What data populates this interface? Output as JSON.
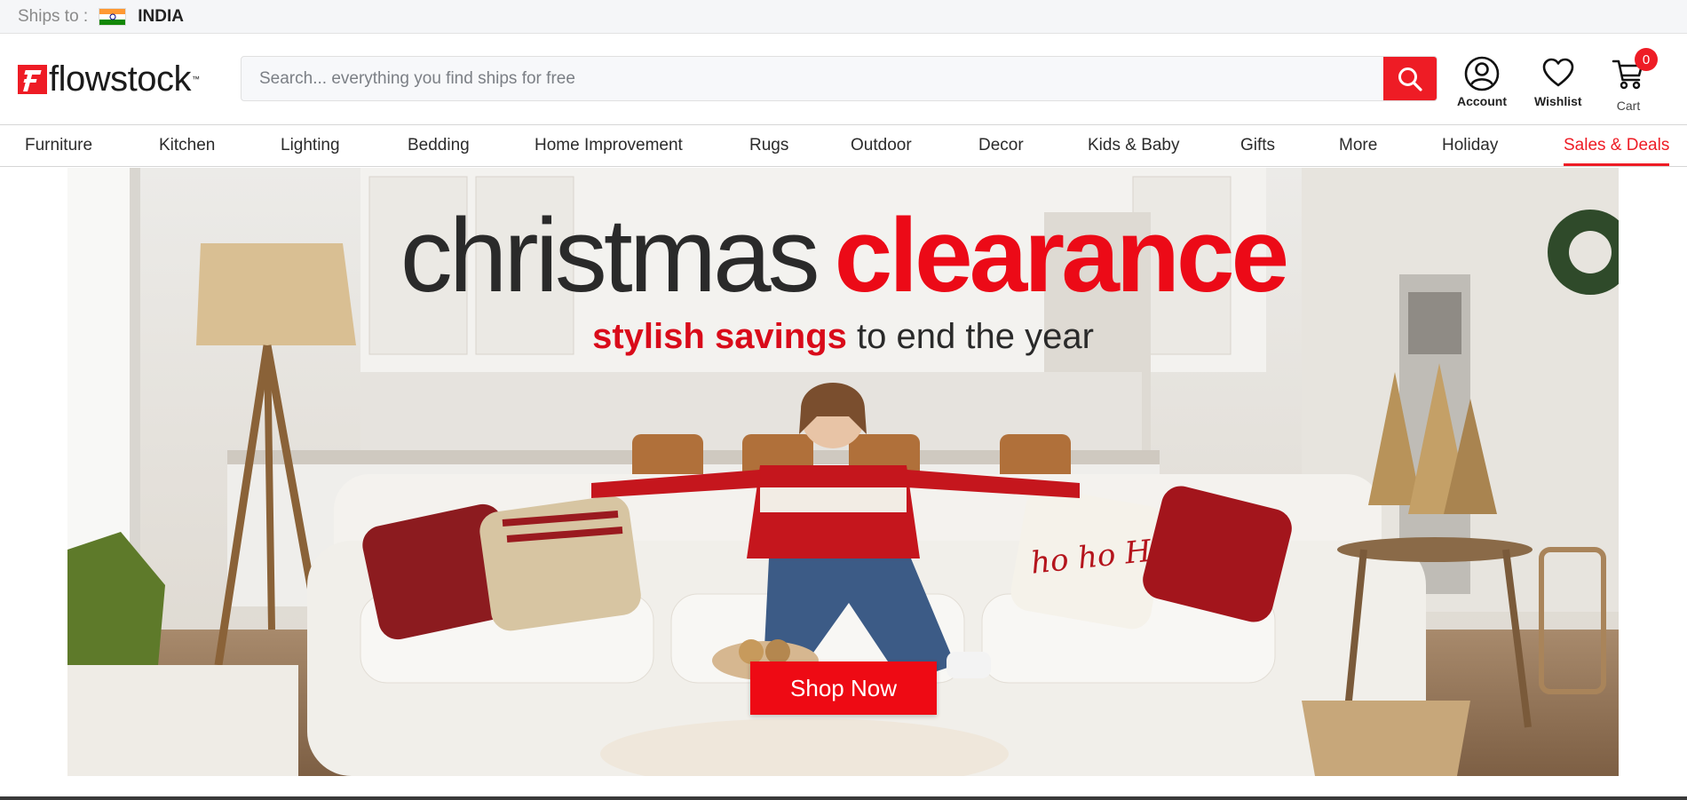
{
  "shipbar": {
    "label": "Ships to :",
    "country": "INDIA",
    "flag_icon": "india-flag-icon"
  },
  "header": {
    "logo_text": "flowstock",
    "logo_tm": "™",
    "search_placeholder": "Search... everything you find ships for free",
    "account_label": "Account",
    "wishlist_label": "Wishlist",
    "cart_label": "Cart",
    "cart_count": "0"
  },
  "nav": {
    "items": [
      {
        "label": "Furniture"
      },
      {
        "label": "Kitchen"
      },
      {
        "label": "Lighting"
      },
      {
        "label": "Bedding"
      },
      {
        "label": "Home Improvement"
      },
      {
        "label": "Rugs"
      },
      {
        "label": "Outdoor"
      },
      {
        "label": "Decor"
      },
      {
        "label": "Kids & Baby"
      },
      {
        "label": "Gifts"
      },
      {
        "label": "More"
      },
      {
        "label": "Holiday"
      },
      {
        "label": "Sales & Deals"
      }
    ],
    "active": "Sales & Deals"
  },
  "hero": {
    "headline_1": "christmas",
    "headline_2": "clearance",
    "sub_red": "stylish savings",
    "sub_dark": "to end the year",
    "pillow_text": "ho ho HO!",
    "cta": "Shop Now"
  },
  "colors": {
    "accent": "#ee1c25",
    "text": "#222222"
  }
}
